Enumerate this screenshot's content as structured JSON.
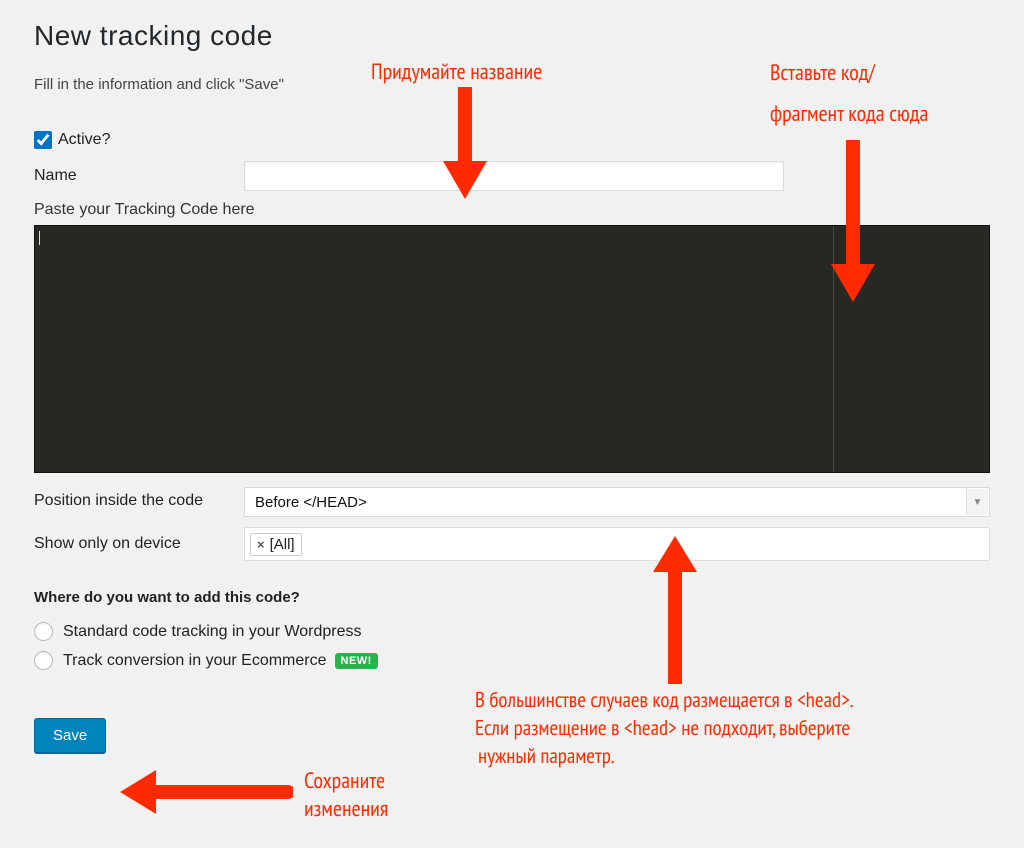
{
  "page": {
    "title": "New tracking code",
    "instruction": "Fill in the information and click \"Save\""
  },
  "form": {
    "active_label": "Active?",
    "active_checked": true,
    "name_label": "Name",
    "name_value": "",
    "paste_label": "Paste your Tracking Code here",
    "position_label": "Position inside the code",
    "position_value": "Before </HEAD>",
    "device_label": "Show only on device",
    "device_tag": "[All]"
  },
  "radio": {
    "question": "Where do you want to add this code?",
    "opt1": "Standard code tracking in your Wordpress",
    "opt2": "Track conversion in your Ecommerce",
    "new_badge": "NEW!"
  },
  "buttons": {
    "save": "Save"
  },
  "annotations": {
    "name_anno": "Придумайте название",
    "code_anno_l1": "Вставьте код/",
    "code_anno_l2": "фрагмент кода сюда",
    "position_anno_l1": "В большинстве случаев код размещается в <head>.",
    "position_anno_l2": "Если размещение в <head> не подходит, выберите",
    "position_anno_l3": "нужный параметр.",
    "save_anno_l1": "Сохраните",
    "save_anno_l2": "изменения"
  }
}
